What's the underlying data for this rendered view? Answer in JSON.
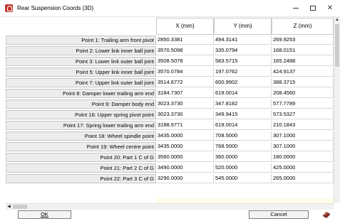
{
  "window": {
    "title": "Rear Suspension Coords (3D)",
    "controls": {
      "minimize": "minimize",
      "maximize": "maximize",
      "close": "✕"
    }
  },
  "columns": [
    "X (mm)",
    "Y (mm)",
    "Z (mm)"
  ],
  "rows": [
    {
      "label": "Point 1: Trailing arm front pivot",
      "x": "2850.3381",
      "y": "494.3141",
      "z": "269.9253"
    },
    {
      "label": "Point 2: Lower link inner ball joint",
      "x": "3570.5098",
      "y": "335.0794",
      "z": "168.0151"
    },
    {
      "label": "Point 3: Lower link outer ball joint",
      "x": "3508.5078",
      "y": "583.5715",
      "z": "165.2488"
    },
    {
      "label": "Point 5: Upper link inner ball joint",
      "x": "3570.0784",
      "y": "197.0762",
      "z": "424.9137"
    },
    {
      "label": "Point 7: Upper link outer ball joint",
      "x": "3514.8772",
      "y": "600.9902",
      "z": "388.3715"
    },
    {
      "label": "Point 8: Damper lower trailing arm end",
      "x": "3184.7307",
      "y": "619.0014",
      "z": "208.4560"
    },
    {
      "label": "Point 9: Damper body end",
      "x": "3023.3730",
      "y": "347.8182",
      "z": "577.7789"
    },
    {
      "label": "Point 16: Upper spring pivot point",
      "x": "3023.3730",
      "y": "349.9415",
      "z": "573.5327"
    },
    {
      "label": "Point 17: Spring lower trailing arm end",
      "x": "3188.9771",
      "y": "619.0014",
      "z": "210.1843"
    },
    {
      "label": "Point 18: Wheel spindle point",
      "x": "3435.0000",
      "y": "708.5000",
      "z": "307.1000"
    },
    {
      "label": "Point 19: Wheel centre point",
      "x": "3435.0000",
      "y": "768.5000",
      "z": "307.1000"
    },
    {
      "label": "Point 20: Part 1 C of G",
      "x": "3560.0000",
      "y": "360.0000",
      "z": "180.0000"
    },
    {
      "label": "Point 21: Part 2 C of G",
      "x": "3490.0000",
      "y": "520.0000",
      "z": "425.0000"
    },
    {
      "label": "Point 22: Part 3 C of G",
      "x": "3290.0000",
      "y": "545.0000",
      "z": "265.0000"
    }
  ],
  "buttons": {
    "ok": "OK",
    "cancel": "Cancel"
  },
  "icons": {
    "app": "suspension-app-icon",
    "help": "help-book-icon"
  },
  "colors": {
    "empty_area": "#fffde8",
    "row_header_bg": "#ececec",
    "app_icon": "#c0392b"
  }
}
